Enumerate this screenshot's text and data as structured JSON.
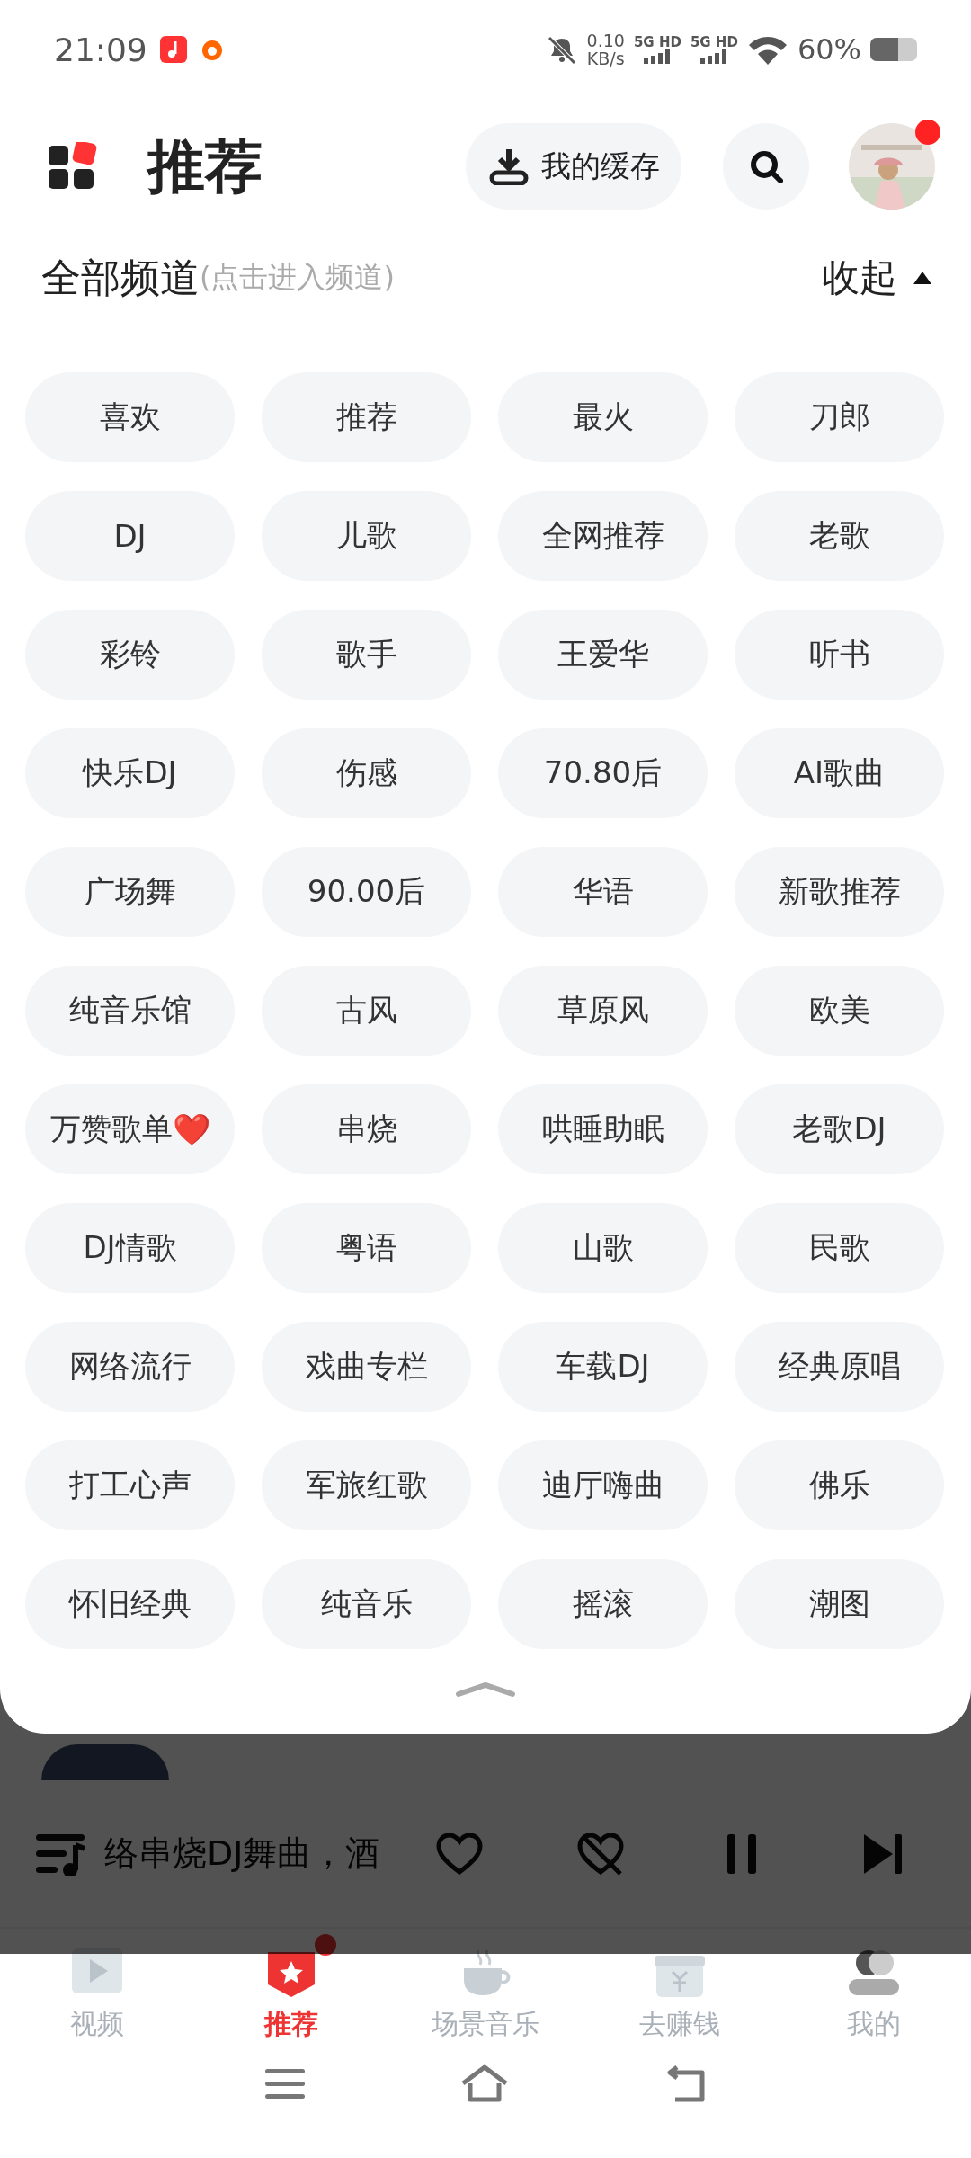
{
  "status_bar": {
    "time": "21:09",
    "speed": "0.10",
    "speed_unit": "KB/s",
    "signals": [
      "5G HD",
      "5G HD"
    ],
    "battery": "60%"
  },
  "header": {
    "title": "推荐",
    "cache_button": "我的缓存",
    "avatar_badge": true
  },
  "channels": {
    "title": "全部频道",
    "hint": "(点击进入频道)",
    "collapse": "收起",
    "chips": [
      {
        "label": "喜欢"
      },
      {
        "label": "推荐"
      },
      {
        "label": "最火"
      },
      {
        "label": "刀郎"
      },
      {
        "label": "DJ"
      },
      {
        "label": "儿歌"
      },
      {
        "label": "全网推荐"
      },
      {
        "label": "老歌"
      },
      {
        "label": "彩铃"
      },
      {
        "label": "歌手"
      },
      {
        "label": "王爱华"
      },
      {
        "label": "听书"
      },
      {
        "label": "快乐DJ"
      },
      {
        "label": "伤感"
      },
      {
        "label": "70.80后"
      },
      {
        "label": "AI歌曲"
      },
      {
        "label": "广场舞"
      },
      {
        "label": "90.00后"
      },
      {
        "label": "华语"
      },
      {
        "label": "新歌推荐"
      },
      {
        "label": "纯音乐馆"
      },
      {
        "label": "古风"
      },
      {
        "label": "草原风"
      },
      {
        "label": "欧美"
      },
      {
        "label": "万赞歌单",
        "emoji": "❤️"
      },
      {
        "label": "串烧"
      },
      {
        "label": "哄睡助眠"
      },
      {
        "label": "老歌DJ"
      },
      {
        "label": "DJ情歌"
      },
      {
        "label": "粤语"
      },
      {
        "label": "山歌"
      },
      {
        "label": "民歌"
      },
      {
        "label": "网络流行"
      },
      {
        "label": "戏曲专栏"
      },
      {
        "label": "车载DJ"
      },
      {
        "label": "经典原唱"
      },
      {
        "label": "打工心声"
      },
      {
        "label": "军旅红歌"
      },
      {
        "label": "迪厅嗨曲"
      },
      {
        "label": "佛乐"
      },
      {
        "label": "怀旧经典"
      },
      {
        "label": "纯音乐"
      },
      {
        "label": "摇滚"
      },
      {
        "label": "潮图"
      }
    ]
  },
  "player": {
    "title": "络串烧DJ舞曲，酒",
    "liked": false,
    "playing": true
  },
  "tabs": [
    {
      "label": "视频",
      "kind": "video",
      "selected": false,
      "badge": false
    },
    {
      "label": "推荐",
      "kind": "recommend",
      "selected": true,
      "badge": true
    },
    {
      "label": "场景音乐",
      "kind": "scene",
      "selected": false,
      "badge": false
    },
    {
      "label": "去赚钱",
      "kind": "earn",
      "selected": false,
      "badge": false
    },
    {
      "label": "我的",
      "kind": "me",
      "selected": false,
      "badge": false
    }
  ]
}
